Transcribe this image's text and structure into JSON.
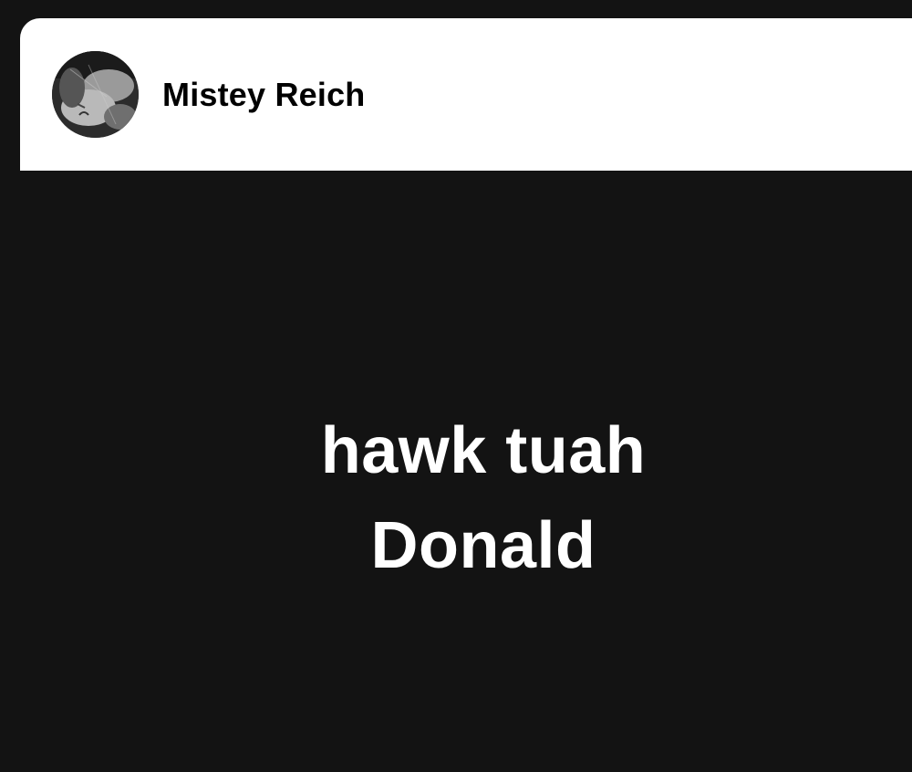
{
  "post": {
    "author_name": "Mistey Reich",
    "avatar_icon": "profile-photo-icon"
  },
  "story": {
    "lines": [
      "hawk tuah",
      "Donald"
    ],
    "text_color": "#ffffff",
    "background_color": "#131313"
  }
}
